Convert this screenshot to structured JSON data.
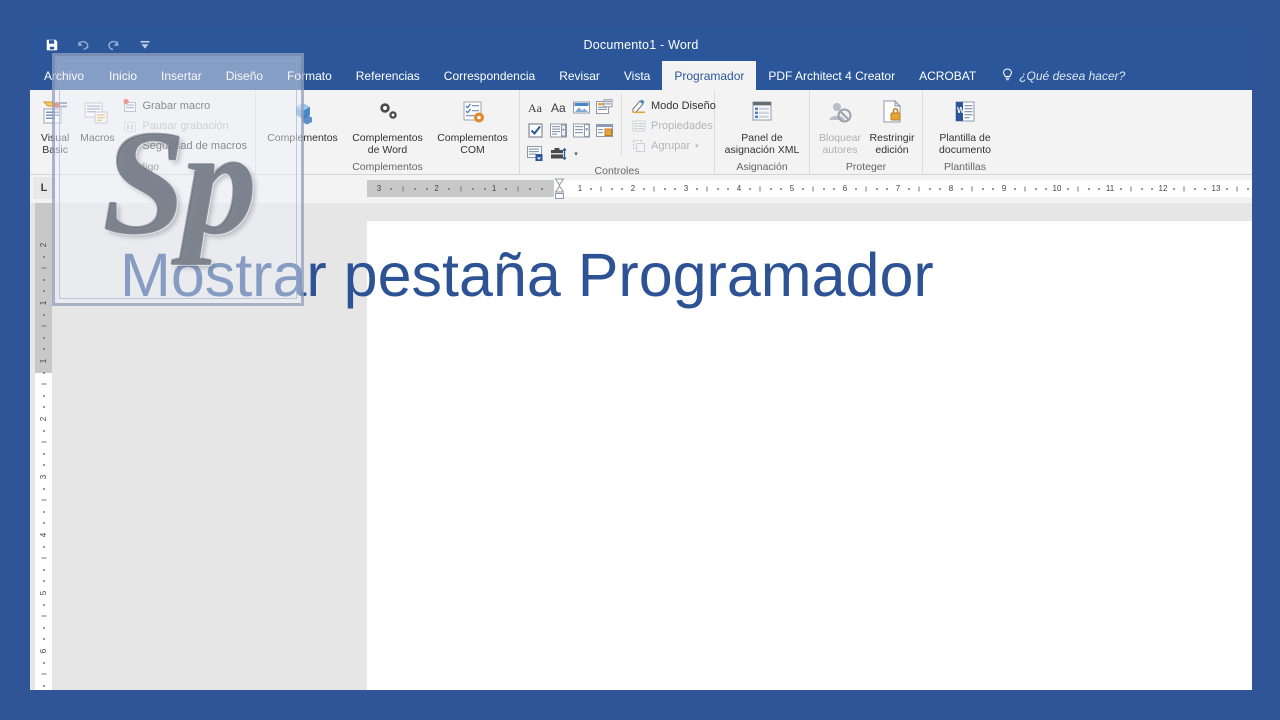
{
  "window": {
    "title": "Documento1  -  Word"
  },
  "quick_access": [
    {
      "name": "save-icon",
      "label": "Guardar",
      "enabled": true
    },
    {
      "name": "undo-icon",
      "label": "Deshacer",
      "enabled": false
    },
    {
      "name": "redo-icon",
      "label": "Rehacer",
      "enabled": false
    },
    {
      "name": "customize-qat-icon",
      "label": "Personalizar barra de herramientas de acceso rápido",
      "enabled": true
    }
  ],
  "tabs": [
    {
      "label": "Archivo",
      "active": false
    },
    {
      "label": "Inicio",
      "active": false
    },
    {
      "label": "Insertar",
      "active": false
    },
    {
      "label": "Diseño",
      "active": false
    },
    {
      "label": "Formato",
      "active": false
    },
    {
      "label": "Referencias",
      "active": false
    },
    {
      "label": "Correspondencia",
      "active": false
    },
    {
      "label": "Revisar",
      "active": false
    },
    {
      "label": "Vista",
      "active": false
    },
    {
      "label": "Programador",
      "active": true
    },
    {
      "label": "PDF Architect 4 Creator",
      "active": false
    },
    {
      "label": "ACROBAT",
      "active": false
    }
  ],
  "tell_me": {
    "icon": "lightbulb-icon",
    "text": "¿Qué desea hacer?"
  },
  "ribbon": {
    "groups": [
      {
        "id": "codigo",
        "label": "Código",
        "big_buttons": [
          {
            "id": "visual-basic",
            "line1": "Visual",
            "line2": "Basic",
            "icon": "visual-basic-icon",
            "enabled": true
          },
          {
            "id": "macros",
            "line1": "Macros",
            "line2": "",
            "icon": "macros-icon",
            "enabled": true
          }
        ],
        "small_buttons": [
          {
            "id": "grabar-macro",
            "label": "Grabar macro",
            "icon": "record-macro-icon",
            "enabled": true,
            "caret": false
          },
          {
            "id": "pausar-grabacion",
            "label": "Pausar grabación",
            "icon": "pause-recording-icon",
            "enabled": false,
            "caret": false
          },
          {
            "id": "seguridad-macros",
            "label": "Seguridad de macros",
            "icon": "macro-security-icon",
            "enabled": true,
            "caret": false
          }
        ]
      },
      {
        "id": "complementos",
        "label": "Complementos",
        "big_buttons": [
          {
            "id": "complementos",
            "line1": "Complementos",
            "line2": "",
            "icon": "addins-store-icon",
            "enabled": true
          },
          {
            "id": "complementos-de-word",
            "line1": "Complementos",
            "line2": "de Word",
            "icon": "word-addins-icon",
            "enabled": true
          },
          {
            "id": "complementos-com",
            "line1": "Complementos",
            "line2": "COM",
            "icon": "com-addins-icon",
            "enabled": true
          }
        ],
        "small_buttons": []
      },
      {
        "id": "controles",
        "label": "Controles",
        "grid_icons": [
          "rich-text-content-control-icon",
          "plain-text-content-control-icon",
          "picture-content-control-icon",
          "building-block-gallery-icon",
          "checkbox-content-control-icon",
          "combo-box-content-control-icon",
          "drop-down-list-content-control-icon",
          "date-picker-content-control-icon",
          "repeating-section-content-control-icon",
          "legacy-tools-icon"
        ],
        "small_buttons": [
          {
            "id": "modo-diseno",
            "label": "Modo Diseño",
            "icon": "design-mode-icon",
            "enabled": true,
            "caret": false
          },
          {
            "id": "propiedades",
            "label": "Propiedades",
            "icon": "properties-icon",
            "enabled": false,
            "caret": false
          },
          {
            "id": "agrupar",
            "label": "Agrupar",
            "icon": "group-icon",
            "enabled": false,
            "caret": true
          }
        ]
      },
      {
        "id": "asignacion",
        "label": "Asignación",
        "big_buttons": [
          {
            "id": "panel-asignacion-xml",
            "line1": "Panel de",
            "line2": "asignación XML",
            "icon": "xml-mapping-pane-icon",
            "enabled": true
          }
        ],
        "small_buttons": []
      },
      {
        "id": "proteger",
        "label": "Proteger",
        "big_buttons": [
          {
            "id": "bloquear-autores",
            "line1": "Bloquear",
            "line2": "autores",
            "icon": "block-authors-icon",
            "enabled": false,
            "caret": true
          },
          {
            "id": "restringir-edicion",
            "line1": "Restringir",
            "line2": "edición",
            "icon": "restrict-editing-icon",
            "enabled": true,
            "caret": false
          }
        ],
        "small_buttons": []
      },
      {
        "id": "plantillas",
        "label": "Plantillas",
        "big_buttons": [
          {
            "id": "plantilla-de-documento",
            "line1": "Plantilla de",
            "line2": "documento",
            "icon": "document-template-icon",
            "enabled": true
          }
        ],
        "small_buttons": []
      }
    ]
  },
  "ruler": {
    "tab_stop_marker": "L",
    "horizontal_left_ticks": [
      "3",
      "2",
      "1"
    ],
    "horizontal_right_ticks": [
      "1",
      "2",
      "3",
      "4",
      "5",
      "6",
      "7",
      "8",
      "9",
      "10",
      "11",
      "12",
      "13"
    ],
    "vertical_ticks": [
      "2",
      "1",
      "1",
      "2",
      "3",
      "4",
      "5",
      "6"
    ]
  },
  "document": {
    "heading": "Mostrar pestaña Programador"
  },
  "overlay": {
    "logo_text": "Sp"
  },
  "colors": {
    "word_blue": "#2b579a",
    "frame_blue": "#2f5597",
    "ribbon_bg": "#f3f3f3",
    "heading_blue": "#2e5395",
    "page_bg": "#e6e6e6"
  }
}
